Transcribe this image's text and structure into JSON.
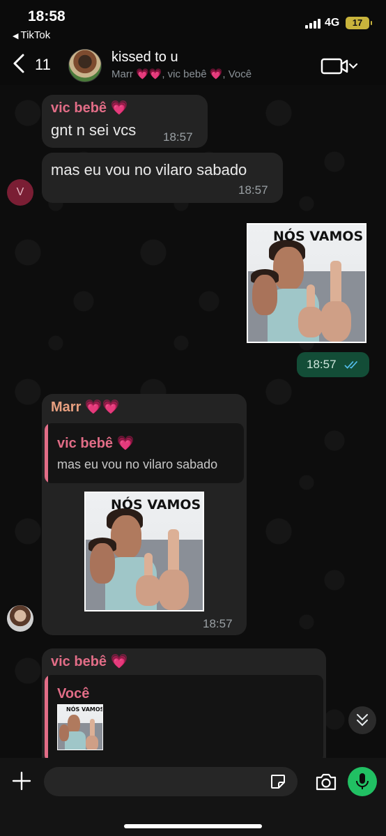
{
  "status_bar": {
    "time": "18:58",
    "back_app": "TikTok",
    "network": "4G",
    "battery": "17"
  },
  "header": {
    "back_count": "11",
    "title": "kissed to u",
    "participants": "Marr 💗💗, vic bebê 💗, Você",
    "icons": [
      "chevron-left-icon",
      "video-call-icon",
      "chevron-down-icon"
    ]
  },
  "messages": [
    {
      "sender": "vic bebê 💗",
      "text": "gnt n sei vcs",
      "time": "18:57"
    },
    {
      "text": "mas eu vou no vilaro sabado",
      "time": "18:57",
      "avatar_letter": "V"
    },
    {
      "type": "image",
      "outgoing": true,
      "caption": "NÓS VAMOS",
      "time": "18:57",
      "status": "read"
    },
    {
      "sender": "Marr 💗💗",
      "reply_to": {
        "sender": "vic bebê 💗",
        "text": "mas eu vou no vilaro sabado"
      },
      "image_caption": "NÓS VAMOS",
      "time": "18:57"
    },
    {
      "sender": "vic bebê 💗",
      "reply_to": {
        "sender": "Você",
        "image_caption": "NÓS VAMOS"
      }
    }
  ],
  "input": {
    "placeholder": "",
    "icons": [
      "plus-icon",
      "sticker-icon",
      "camera-icon",
      "microphone-icon"
    ]
  },
  "colors": {
    "background": "#0b0b0b",
    "incoming_bubble": "#232323",
    "outgoing_bubble": "#134d37",
    "accent_pink": "#e26d87",
    "accent_orange": "#e8a080",
    "mic_green": "#21c063",
    "read_tick": "#53bdeb"
  }
}
